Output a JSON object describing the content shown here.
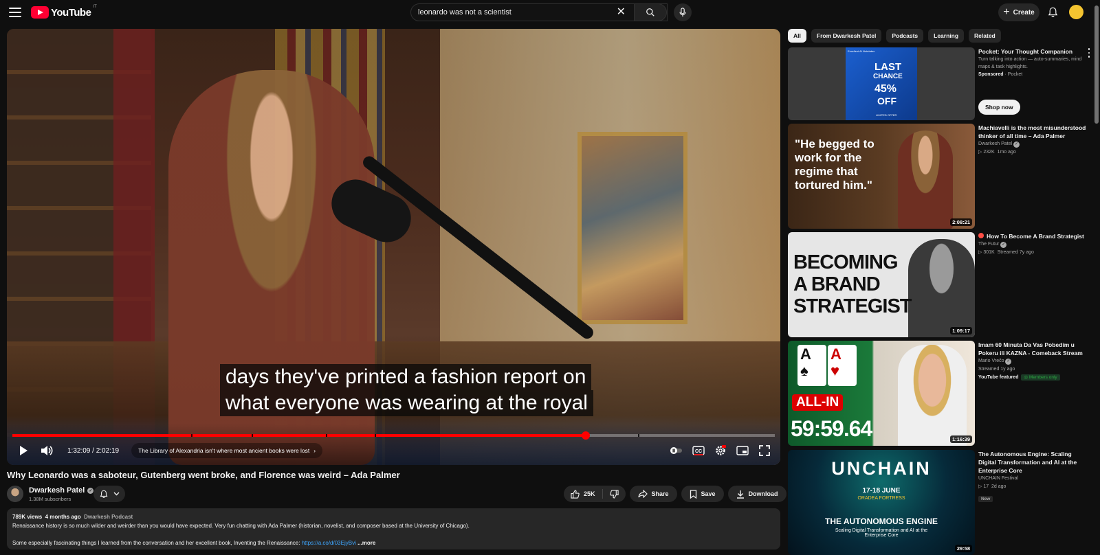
{
  "header": {
    "logo_text": "YouTube",
    "logo_country": "IT",
    "search_value": "leonardo was not a scientist",
    "search_placeholder": "Search",
    "create_label": "Create"
  },
  "player": {
    "subtitle_line1": "days they've printed a fashion report on",
    "subtitle_line2": "what everyone was wearing at the royal",
    "time_display": "1:32:09 / 2:02:19",
    "progress_fraction": 0.752,
    "chapter_label": "The Library of Alexandria isn't where most ancient books were lost"
  },
  "video": {
    "title": "Why Leonardo was a saboteur, Gutenberg went broke, and Florence was weird – Ada Palmer",
    "channel_name": "Dwarkesh Patel",
    "subscribers": "1.38M subscribers",
    "like_count": "25K",
    "share_label": "Share",
    "save_label": "Save",
    "download_label": "Download",
    "views": "789K views",
    "age": "4 months ago",
    "tag": "Dwarkesh Podcast",
    "desc_line1": "Renaissance history is so much wilder and weirder than you would have expected. Very fun chatting with Ada Palmer (historian, novelist, and composer based at the University of Chicago).",
    "desc_line2": "Some especially fascinating things I learned from the conversation and her excellent book, Inventing the Renaissance: ",
    "desc_link": "https://a.co/d/03EjyBvi",
    "desc_more": "...more"
  },
  "chips": [
    "All",
    "From Dwarkesh Patel",
    "Podcasts",
    "Learning",
    "Related"
  ],
  "recommendations": [
    {
      "title": "Pocket: Your Thought Companion",
      "desc": "Turn talking into action — auto-summaries, mind maps & task highlights.",
      "sponsored": "Sponsored",
      "advertiser": "Pocket",
      "cta": "Shop now",
      "thumb_text1": "Excellent AI Notetaker",
      "thumb_text2": "LAST",
      "thumb_text3": "CHANCE",
      "thumb_text4": "45%",
      "thumb_text5": "OFF",
      "thumb_text6": "LIMITED OFFER"
    },
    {
      "title": "Machiavelli is the most misunderstood thinker of all time – Ada Palmer",
      "channel": "Dwarkesh Patel",
      "views": "232K",
      "age": "1mo ago",
      "duration": "2:08:21",
      "thumb_quote": "\"He begged to work for the regime that tortured him.\""
    },
    {
      "title": "How To Become A Brand Strategist",
      "channel": "The Futur",
      "views": "301K",
      "age": "Streamed 7y ago",
      "duration": "1:09:17",
      "thumb_text": "BECOMING A BRAND STRATEGIST"
    },
    {
      "title": "Imam 60 Minuta Da Vas Pobedim u Pokeru ili KAZNA - Comeback Stream",
      "channel": "Mario Vrečo",
      "age": "Streamed 1y ago",
      "featured": "YouTube featured",
      "members": "Members only",
      "duration": "1:16:39",
      "thumb_text1": "ALL-IN",
      "thumb_text2": "59:59.64"
    },
    {
      "title": "The Autonomous Engine: Scaling Digital Transformation and AI at the Enterprise Core",
      "channel": "UNCHAIN Festival",
      "views": "17",
      "age": "2d ago",
      "badge": "New",
      "duration": "29:58",
      "thumb_text1": "UNCHAIN",
      "thumb_text2": "17-18 JUNE",
      "thumb_text3": "ORADEA FORTRESS",
      "thumb_text4": "THE AUTONOMOUS ENGINE",
      "thumb_text5": "Scaling Digital Transformation and AI at the Enterprise Core"
    }
  ],
  "colors": {
    "accent": "#ff0000",
    "background": "#0f0f0f",
    "chip_bg": "#272727",
    "link": "#3ea6ff"
  }
}
